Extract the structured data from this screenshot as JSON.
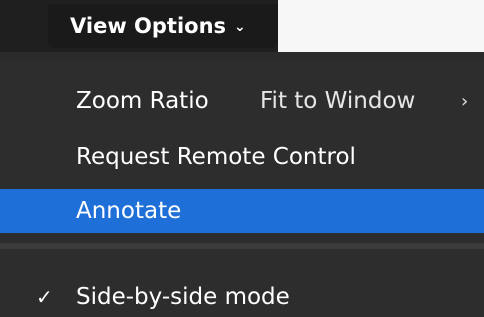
{
  "toolbar": {
    "view_options_label": "View Options",
    "view_options_chevron": "⌄"
  },
  "menu": {
    "zoom": {
      "label": "Zoom Ratio",
      "value": "Fit to Window",
      "submenu_arrow": "›"
    },
    "remote_control": {
      "label": "Request Remote Control"
    },
    "annotate": {
      "label": "Annotate",
      "highlighted": true
    },
    "side_by_side": {
      "label": "Side-by-side mode",
      "checked": true,
      "check_glyph": "✓"
    }
  },
  "colors": {
    "menu_bg": "#2d2d2d",
    "highlight": "#1f6fd8",
    "text": "#ffffff"
  }
}
